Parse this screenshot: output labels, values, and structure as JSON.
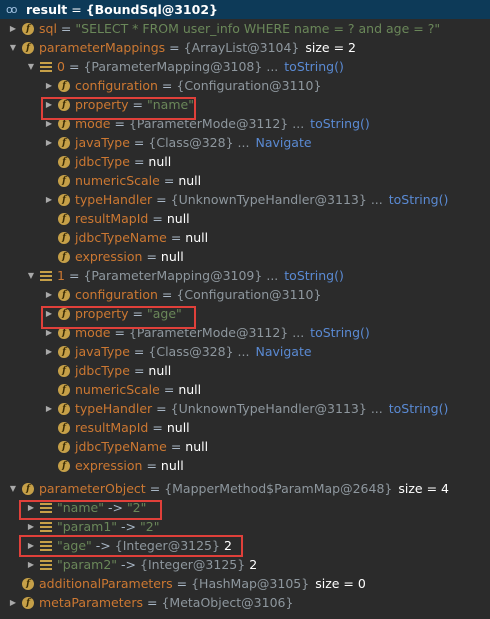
{
  "tree": {
    "root": {
      "name": "result",
      "value": "{BoundSql@3102}"
    },
    "sql": {
      "name": "sql",
      "value": "\"SELECT * FROM user_info WHERE name = ? and age = ?\""
    },
    "parameterMappings": {
      "name": "parameterMappings",
      "value": "{ArrayList@3104}",
      "size": "size = 2"
    },
    "mapping0": {
      "index": "0",
      "value": "{ParameterMapping@3108}",
      "ellipsis": "...",
      "action": "toString()",
      "configuration": {
        "name": "configuration",
        "value": "{Configuration@3110}"
      },
      "property": {
        "name": "property",
        "value": "\"name\""
      },
      "mode": {
        "name": "mode",
        "value": "{ParameterMode@3112}",
        "ellipsis": "...",
        "action": "toString()"
      },
      "javaType": {
        "name": "javaType",
        "value": "{Class@328}",
        "ellipsis": "...",
        "action": "Navigate"
      },
      "jdbcType": {
        "name": "jdbcType",
        "value": "null"
      },
      "numericScale": {
        "name": "numericScale",
        "value": "null"
      },
      "typeHandler": {
        "name": "typeHandler",
        "value": "{UnknownTypeHandler@3113}",
        "ellipsis": "...",
        "action": "toString()"
      },
      "resultMapId": {
        "name": "resultMapId",
        "value": "null"
      },
      "jdbcTypeName": {
        "name": "jdbcTypeName",
        "value": "null"
      },
      "expression": {
        "name": "expression",
        "value": "null"
      }
    },
    "mapping1": {
      "index": "1",
      "value": "{ParameterMapping@3109}",
      "ellipsis": "...",
      "action": "toString()",
      "configuration": {
        "name": "configuration",
        "value": "{Configuration@3110}"
      },
      "property": {
        "name": "property",
        "value": "\"age\""
      },
      "mode": {
        "name": "mode",
        "value": "{ParameterMode@3112}",
        "ellipsis": "...",
        "action": "toString()"
      },
      "javaType": {
        "name": "javaType",
        "value": "{Class@328}",
        "ellipsis": "...",
        "action": "Navigate"
      },
      "jdbcType": {
        "name": "jdbcType",
        "value": "null"
      },
      "numericScale": {
        "name": "numericScale",
        "value": "null"
      },
      "typeHandler": {
        "name": "typeHandler",
        "value": "{UnknownTypeHandler@3113}",
        "ellipsis": "...",
        "action": "toString()"
      },
      "resultMapId": {
        "name": "resultMapId",
        "value": "null"
      },
      "jdbcTypeName": {
        "name": "jdbcTypeName",
        "value": "null"
      },
      "expression": {
        "name": "expression",
        "value": "null"
      }
    },
    "parameterObject": {
      "name": "parameterObject",
      "value": "{MapperMethod$ParamMap@2648}",
      "size": "size = 4"
    },
    "entries": [
      {
        "key": "\"name\"",
        "arrow": "->",
        "value": "\"2\"",
        "kind": "str"
      },
      {
        "key": "\"param1\"",
        "arrow": "->",
        "value": "\"2\"",
        "kind": "str"
      },
      {
        "key": "\"age\"",
        "arrow": "->",
        "value": "{Integer@3125}",
        "extra": "2",
        "kind": "obj"
      },
      {
        "key": "\"param2\"",
        "arrow": "->",
        "value": "{Integer@3125}",
        "extra": "2",
        "kind": "obj"
      }
    ],
    "additionalParameters": {
      "name": "additionalParameters",
      "value": "{HashMap@3105}",
      "size": "size = 0"
    },
    "metaParameters": {
      "name": "metaParameters",
      "value": "{MetaObject@3106}"
    }
  },
  "colors": {
    "background": "#2b2b2b",
    "field": "#cc7832",
    "string": "#6a8759",
    "link": "#5a8ad3",
    "highlight": "#e0403a"
  }
}
